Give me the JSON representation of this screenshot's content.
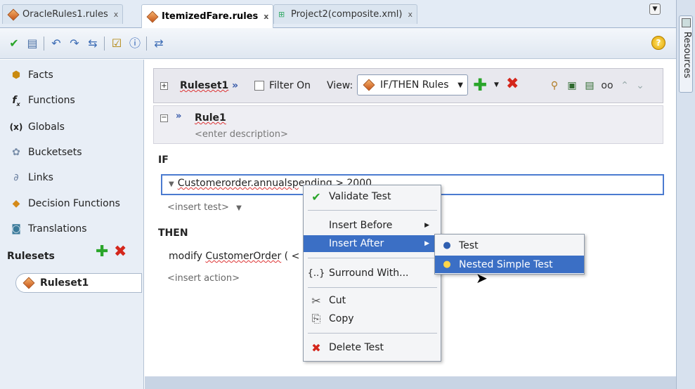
{
  "tabs": [
    {
      "label": "OracleRules1.rules",
      "close": "x"
    },
    {
      "label": "ItemizedFare.rules",
      "close": "x"
    },
    {
      "label": "Project2(composite.xml)",
      "close": "x"
    }
  ],
  "right_panel": {
    "label": "Resources"
  },
  "toolbar": {
    "help": "?"
  },
  "sidebar": {
    "items": [
      {
        "label": "Facts",
        "icon": "facts-icon"
      },
      {
        "label": "Functions",
        "icon": "functions-icon"
      },
      {
        "label": "Globals",
        "icon": "globals-icon"
      },
      {
        "label": "Bucketsets",
        "icon": "bucketsets-icon"
      },
      {
        "label": "Links",
        "icon": "links-icon"
      },
      {
        "label": "Decision Functions",
        "icon": "decision-functions-icon"
      },
      {
        "label": "Translations",
        "icon": "translations-icon"
      }
    ],
    "rulesets_label": "Rulesets",
    "ruleset_item": "Ruleset1"
  },
  "ruleset_header": {
    "title": "Ruleset1",
    "filter_label": "Filter On",
    "view_label": "View:",
    "view_value": "IF/THEN Rules"
  },
  "rule": {
    "name": "Rule1",
    "description": "<enter description>"
  },
  "if_label": "IF",
  "condition": {
    "object": "Customerorder.annualsp",
    "rest": "ending  >  2000"
  },
  "insert_test": "<insert test>",
  "then_label": "THEN",
  "action": {
    "prefix": "modify ",
    "object": "CustomerOrder",
    "suffix": " (  <"
  },
  "insert_action": "<insert action>",
  "context_menu": {
    "validate": "Validate Test",
    "insert_before": "Insert Before",
    "insert_after": "Insert After",
    "surround": "Surround With...",
    "cut": "Cut",
    "copy": "Copy",
    "delete": "Delete Test"
  },
  "submenu": {
    "test": "Test",
    "nested": "Nested Simple Test"
  },
  "colors": {
    "accent": "#3b6fc5",
    "add": "#2aa52a",
    "delete": "#d4261b"
  }
}
